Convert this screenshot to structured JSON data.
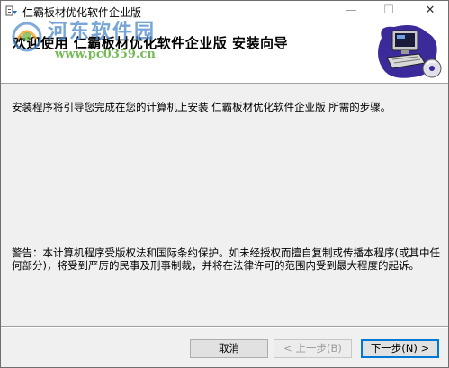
{
  "window": {
    "title": "仁霸板材优化软件企业版",
    "controls": {
      "minimize": "—",
      "maximize": "☐",
      "close": "✕"
    }
  },
  "banner": {
    "title": "欢迎使用 仁霸板材优化软件企业版 安装向导",
    "watermark_main": "河东软件园",
    "watermark_url": "www.pc0359.cn",
    "art_icon": "computer-disc-icon"
  },
  "content": {
    "intro": "安装程序将引导您完成在您的计算机上安装 仁霸板材优化软件企业版 所需的步骤。",
    "warning": "警告：本计算机程序受版权法和国际条约保护。如未经授权而擅自复制或传播本程序(或其中任何部分)，将受到严厉的民事及刑事制裁，并将在法律许可的范围内受到最大程度的起诉。"
  },
  "buttons": {
    "cancel": "取消",
    "back": "< 上一步(B)",
    "next": "下一步(N) >"
  },
  "colors": {
    "accent": "#0078d7",
    "watermark_blue": "#4a87c8",
    "watermark_green": "#5fae3c"
  }
}
